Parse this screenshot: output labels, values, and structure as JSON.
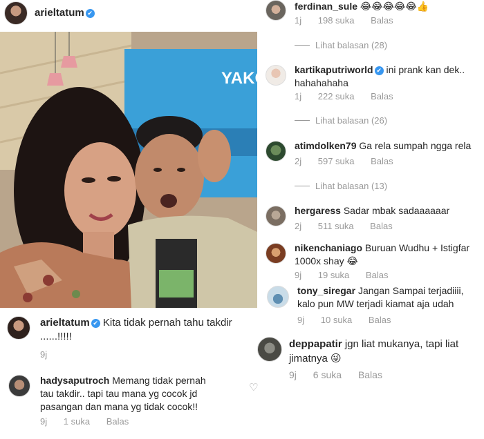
{
  "post": {
    "username": "arieltatum",
    "caption_username": "arieltatum",
    "caption_text": "Kita tidak pernah tahu takdir ......!!!!!",
    "caption_time": "9j"
  },
  "left_comment": {
    "username": "hadysaputroch",
    "text": "Memang tidak pernah tau takdir.. tapi tau mana yg cocok jd pasangan dan mana yg tidak cocok!!",
    "time": "9j",
    "likes": "1 suka",
    "reply": "Balas"
  },
  "comments": [
    {
      "username": "ferdinan_sule",
      "verified": false,
      "text": "😂😂😂😂😂👍",
      "time": "1j",
      "likes": "198 suka",
      "reply": "Balas",
      "replies": "Lihat balasan (28)"
    },
    {
      "username": "kartikaputriworld",
      "verified": true,
      "text": "ini prank kan dek.. hahahahaha",
      "time": "1j",
      "likes": "222 suka",
      "reply": "Balas",
      "replies": "Lihat balasan (26)"
    },
    {
      "username": "atimdolken79",
      "verified": false,
      "text": "Ga rela sumpah ngga rela",
      "time": "2j",
      "likes": "597 suka",
      "reply": "Balas",
      "replies": "Lihat balasan (13)"
    },
    {
      "username": "hergaress",
      "verified": false,
      "text": "Sadar mbak sadaaaaaar",
      "time": "2j",
      "likes": "511 suka",
      "reply": "Balas"
    },
    {
      "username": "nikenchaniago",
      "verified": false,
      "text": "Buruan Wudhu + Istigfar 1000x shay 😂",
      "time": "9j",
      "likes": "19 suka",
      "reply": "Balas"
    },
    {
      "username": "tony_siregar",
      "verified": false,
      "text": "Jangan Sampai terjadiiii, kalo pun MW terjadi kiamat aja udah",
      "time": "9j",
      "likes": "10 suka",
      "reply": "Balas"
    },
    {
      "username": "deppapatir",
      "verified": false,
      "text": "jgn liat mukanya, tapi liat jimatnya 😜",
      "time": "9j",
      "likes": "6 suka",
      "reply": "Balas"
    }
  ],
  "photo_text": {
    "screen_sign": "YAKO"
  },
  "colors": {
    "verified": "#3897f0",
    "muted": "#999999",
    "text": "#262626"
  },
  "icons": {
    "verified": "✔",
    "like": "♡"
  }
}
